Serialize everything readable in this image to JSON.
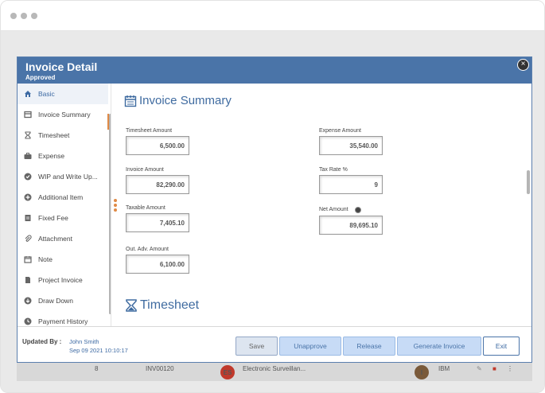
{
  "modal": {
    "title": "Invoice Detail",
    "status": "Approved"
  },
  "sidebar": {
    "items": [
      {
        "label": "Basic",
        "icon": "home-icon",
        "active": true
      },
      {
        "label": "Invoice Summary",
        "icon": "invoice-icon"
      },
      {
        "label": "Timesheet",
        "icon": "hourglass-icon"
      },
      {
        "label": "Expense",
        "icon": "briefcase-icon"
      },
      {
        "label": "WIP and Write Up...",
        "icon": "check-circle-icon"
      },
      {
        "label": "Additional Item",
        "icon": "plus-circle-icon"
      },
      {
        "label": "Fixed Fee",
        "icon": "document-icon"
      },
      {
        "label": "Attachment",
        "icon": "paperclip-icon"
      },
      {
        "label": "Note",
        "icon": "calendar-icon"
      },
      {
        "label": "Project Invoice",
        "icon": "file-icon"
      },
      {
        "label": "Draw Down",
        "icon": "download-circle-icon"
      },
      {
        "label": "Payment History",
        "icon": "history-icon"
      }
    ]
  },
  "invoice_summary": {
    "title": "Invoice Summary",
    "fields": {
      "timesheet_amount": {
        "label": "Timesheet Amount",
        "value": "6,500.00"
      },
      "expense_amount": {
        "label": "Expense Amount",
        "value": "35,540.00"
      },
      "invoice_amount": {
        "label": "Invoice Amount",
        "value": "82,290.00"
      },
      "tax_rate": {
        "label": "Tax Rate %",
        "value": "9"
      },
      "taxable_amount": {
        "label": "Taxable Amount",
        "value": "7,405.10"
      },
      "net_amount": {
        "label": "Net Amount",
        "value": "89,695.10"
      },
      "out_adv_amount": {
        "label": "Out. Adv. Amount",
        "value": "6,100.00"
      }
    }
  },
  "timesheet": {
    "title": "Timesheet"
  },
  "footer": {
    "updated_by_label": "Updated By :",
    "updated_by_name": "John Smith",
    "updated_date": "Sep 09 2021 10:10:17",
    "buttons": {
      "save": "Save",
      "unapprove": "Unapprove",
      "release": "Release",
      "generate_invoice": "Generate Invoice",
      "exit": "Exit"
    }
  },
  "background_row": {
    "number": "8",
    "invoice": "INV00120",
    "client_initials": "ES",
    "client_name": "Electronic Surveillan...",
    "manager_initial": "I",
    "company": "IBM"
  },
  "colors": {
    "header": "#4a74a8",
    "accent": "#3d6aa3",
    "handle": "#e08a45"
  }
}
